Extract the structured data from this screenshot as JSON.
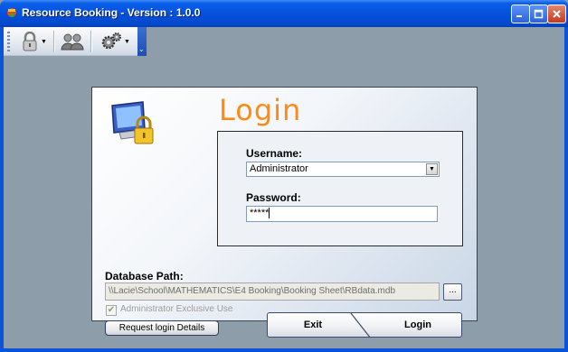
{
  "window": {
    "title": "Resource Booking - Version : 1.0.0",
    "controls": [
      "minimize",
      "maximize",
      "close"
    ]
  },
  "toolbar": {
    "items": [
      {
        "icon": "lock-icon",
        "has_dropdown": true
      },
      {
        "icon": "users-icon",
        "has_dropdown": false
      },
      {
        "icon": "gears-icon",
        "has_dropdown": true
      }
    ]
  },
  "login": {
    "title": "Login",
    "username_label": "Username:",
    "username_value": "Administrator",
    "password_label": "Password:",
    "password_value": "*****",
    "database_path_label": "Database Path:",
    "database_path_value": "\\\\Lacie\\School\\MATHEMATICS\\E4 Booking\\Booking Sheet\\RBdata.mdb",
    "browse_label": "...",
    "admin_exclusive_label": "Administrator Exclusive Use",
    "admin_exclusive_checked": true,
    "request_button_label": "Request login Details",
    "exit_button_label": "Exit",
    "login_button_label": "Login"
  },
  "colors": {
    "title_accent": "#ff8a14",
    "titlebar": "#0551de",
    "client_bg": "#8e9daa"
  }
}
